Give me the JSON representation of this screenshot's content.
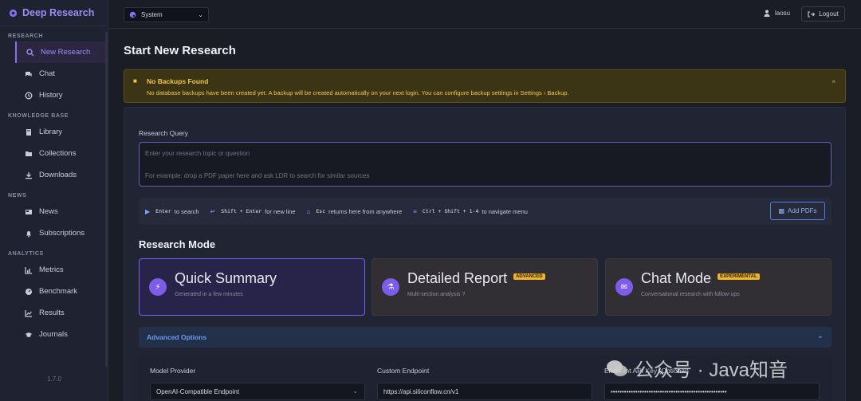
{
  "brand": {
    "name": "Deep Research"
  },
  "sidebar": {
    "sections": [
      {
        "label": "RESEARCH",
        "items": [
          {
            "label": "New Research",
            "icon": "search-icon",
            "active": true
          },
          {
            "label": "Chat",
            "icon": "chat-icon"
          },
          {
            "label": "History",
            "icon": "history-icon"
          }
        ]
      },
      {
        "label": "KNOWLEDGE BASE",
        "items": [
          {
            "label": "Library",
            "icon": "book-icon"
          },
          {
            "label": "Collections",
            "icon": "folder-icon"
          },
          {
            "label": "Downloads",
            "icon": "download-icon"
          }
        ]
      },
      {
        "label": "NEWS",
        "items": [
          {
            "label": "News",
            "icon": "newspaper-icon"
          },
          {
            "label": "Subscriptions",
            "icon": "bell-icon"
          }
        ]
      },
      {
        "label": "ANALYTICS",
        "items": [
          {
            "label": "Metrics",
            "icon": "bar-chart-icon"
          },
          {
            "label": "Benchmark",
            "icon": "gauge-icon"
          },
          {
            "label": "Results",
            "icon": "line-chart-icon"
          },
          {
            "label": "Journals",
            "icon": "graduation-cap-icon"
          }
        ]
      }
    ],
    "version": "1.7.0"
  },
  "topbar": {
    "theme_select": "System",
    "username": "laosu",
    "logout_label": "Logout"
  },
  "main": {
    "title": "Start New Research",
    "alert": {
      "title": "No Backups Found",
      "message": "No database backups have been created yet. A backup will be created automatically on your next login. You can configure backup settings in Settings › Backup.",
      "close": "×"
    },
    "query": {
      "label": "Research Query",
      "placeholder_line1": "Enter your research topic or question",
      "placeholder_line2": "For example: drop a PDF paper here and ask LDR to search for similar sources"
    },
    "shortcuts": {
      "enter_key": "Enter",
      "enter_text": "to search",
      "newline_key": "Shift + Enter",
      "newline_text": "for new line",
      "esc_key": "Esc",
      "esc_text": "returns here from anywhere",
      "nav_key": "Ctrl + Shift + 1-4",
      "nav_text": "to navigate menu"
    },
    "add_pdfs_label": "Add PDFs",
    "research_mode": {
      "title": "Research Mode",
      "modes": [
        {
          "title": "Quick Summary",
          "desc": "Generated in a few minutes",
          "badge": ""
        },
        {
          "title": "Detailed Report",
          "desc": "Multi-section analysis ?",
          "badge": "ADVANCED"
        },
        {
          "title": "Chat Mode",
          "desc": "Conversational research with follow-ups",
          "badge": "EXPERIMENTAL"
        }
      ]
    },
    "advanced_options_label": "Advanced Options",
    "fields": {
      "model_provider_label": "Model Provider",
      "model_provider_value": "OpenAI-Compatible Endpoint",
      "custom_endpoint_label": "Custom Endpoint",
      "custom_endpoint_value": "https://api.siliconflow.cn/v1",
      "api_key_label": "Endpoint API Key (Optional)",
      "api_key_value": "••••••••••••••••••••••••••••••••••••••••••••••••••••"
    }
  },
  "watermark": {
    "text": "公众号 · Java知音"
  },
  "colors": {
    "accent": "#8b6df5",
    "alert_text": "#f5c542",
    "link": "#6d9bf0",
    "badge": "#f0b429"
  }
}
